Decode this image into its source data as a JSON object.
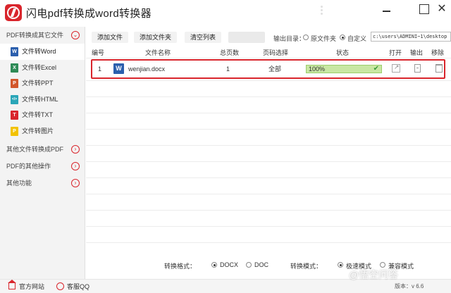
{
  "app": {
    "title": "闪电pdf转换成word转换器"
  },
  "sidebar": {
    "top_category": "PDF转换成其它文件",
    "items": [
      {
        "label": "文件转Word",
        "icon": "W",
        "color": "#2b5fad"
      },
      {
        "label": "文件转Excel",
        "icon": "X",
        "color": "#2e8b57"
      },
      {
        "label": "文件转PPT",
        "icon": "P",
        "color": "#d2572b"
      },
      {
        "label": "文件转HTML",
        "icon": "</>",
        "color": "#2aa6b8"
      },
      {
        "label": "文件转TXT",
        "icon": "T",
        "color": "#d9252c"
      },
      {
        "label": "文件转图片",
        "icon": "P",
        "color": "#f2c200"
      }
    ],
    "other_categories": [
      "其他文件转换成PDF",
      "PDF的其他操作",
      "其他功能"
    ]
  },
  "toolbar": {
    "add_file": "添加文件",
    "add_folder": "添加文件夹",
    "clear_list": "清空列表",
    "output_dir_label": "输出目录：",
    "opt_source_folder": "原文件夹",
    "opt_custom": "自定义",
    "custom_path": "c:\\users\\ADMINI~1\\desktop"
  },
  "table": {
    "headers": [
      "编号",
      "文件名称",
      "总页数",
      "页码选择",
      "状态",
      "打开",
      "输出",
      "移除"
    ],
    "rows": [
      {
        "index": "1",
        "filename": "wenjian.docx",
        "pages": "1",
        "range": "全部",
        "progress": "100%",
        "progress_value": 100
      }
    ]
  },
  "options": {
    "format_label": "转换格式：",
    "format_docx": "DOCX",
    "format_doc": "DOC",
    "mode_label": "转换模式：",
    "mode_fast": "极速模式",
    "mode_compat": "兼容模式"
  },
  "statusbar": {
    "website": "官方网站",
    "support_qq": "客服QQ",
    "version": "版本：v 6.6"
  },
  "watermark": "@悟空问答"
}
